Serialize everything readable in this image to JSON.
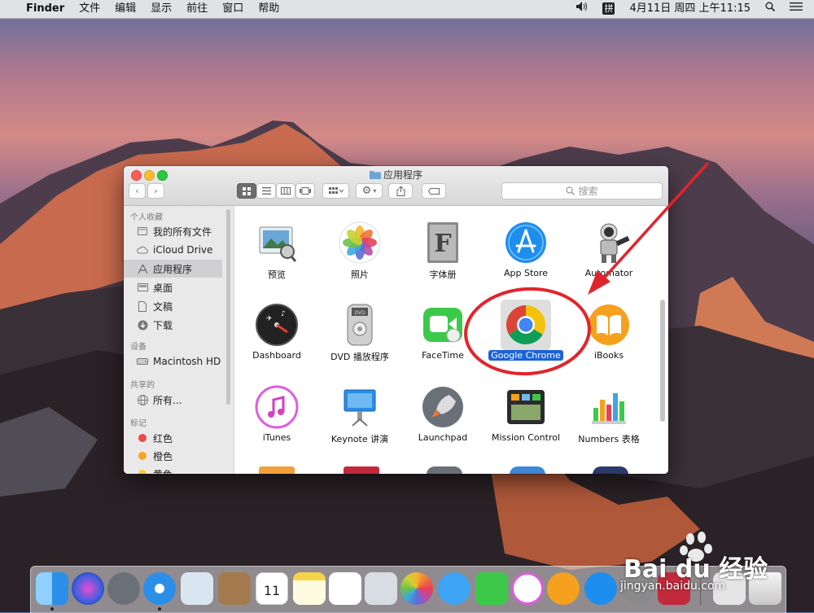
{
  "menubar": {
    "apple": "",
    "app": "Finder",
    "items": [
      "文件",
      "编辑",
      "显示",
      "前往",
      "窗口",
      "帮助"
    ],
    "clock": "4月11日 周四 上午11:15",
    "input_method": "拼"
  },
  "finder": {
    "title": "应用程序",
    "search_placeholder": "搜索",
    "sidebar": {
      "favorites_header": "个人收藏",
      "favorites": [
        "我的所有文件",
        "iCloud Drive",
        "应用程序",
        "桌面",
        "文稿",
        "下载"
      ],
      "devices_header": "设备",
      "devices": [
        "Macintosh HD"
      ],
      "shared_header": "共享的",
      "shared": [
        "所有..."
      ],
      "tags_header": "标记",
      "tags": [
        {
          "label": "红色",
          "color": "#f04747"
        },
        {
          "label": "橙色",
          "color": "#f5a623"
        },
        {
          "label": "黄色",
          "color": "#f5d02d"
        }
      ]
    },
    "apps": [
      "预览",
      "照片",
      "字体册",
      "App Store",
      "Automator",
      "Dashboard",
      "DVD 播放程序",
      "FaceTime",
      "Google Chrome",
      "iBooks",
      "iTunes",
      "Keynote 讲演",
      "Launchpad",
      "Mission Control",
      "Numbers 表格"
    ],
    "selected_app": "Google Chrome"
  },
  "watermark": {
    "brand": "Bai du 经验",
    "url": "jingyan.baidu.com"
  }
}
